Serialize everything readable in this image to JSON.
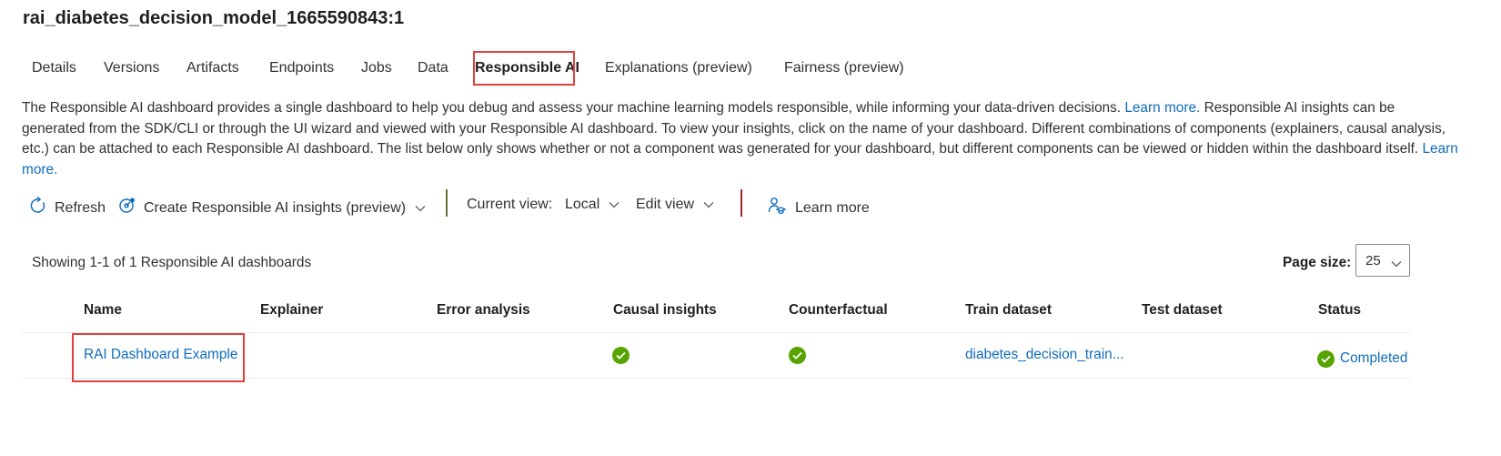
{
  "page_title": "rai_diabetes_decision_model_1665590843:1",
  "tabs": [
    {
      "label": "Details"
    },
    {
      "label": "Versions"
    },
    {
      "label": "Artifacts"
    },
    {
      "label": "Endpoints"
    },
    {
      "label": "Jobs"
    },
    {
      "label": "Data"
    },
    {
      "label": "Responsible AI"
    },
    {
      "label": "Explanations (preview)"
    },
    {
      "label": "Fairness (preview)"
    }
  ],
  "active_tab": "Responsible AI",
  "description": {
    "part1": "The Responsible AI dashboard provides a single dashboard to help you debug and assess your machine learning models responsible, while informing your data-driven decisions.",
    "link1": "Learn more.",
    "part2": "Responsible AI insights can be generated from the SDK/CLI or through the UI wizard and viewed with your Responsible AI dashboard. To view your insights, click on the name of your dashboard. Different combinations of components (explainers, causal analysis, etc.) can be attached to each Responsible AI dashboard. The list below only shows whether or not a component was generated for your dashboard, but different components can be viewed or hidden within the dashboard itself.",
    "link2": "Learn more."
  },
  "toolbar": {
    "refresh": "Refresh",
    "create": "Create Responsible AI insights (preview)",
    "current_view_label": "Current view:",
    "current_view_value": "Local",
    "edit_view": "Edit view",
    "learn_more": "Learn more",
    "icons": [
      "refresh-icon",
      "insights-icon",
      "learn-icon"
    ]
  },
  "list": {
    "showing": "Showing 1-1 of 1 Responsible AI dashboards",
    "page_size_label": "Page size:",
    "page_size_value": "25"
  },
  "table": {
    "columns": [
      "Name",
      "Explainer",
      "Error analysis",
      "Causal insights",
      "Counterfactual",
      "Train dataset",
      "Test dataset",
      "Status"
    ],
    "rows": [
      {
        "name": "RAI Dashboard Example",
        "explainer": "",
        "error_analysis": "",
        "causal_insights": true,
        "counterfactual": true,
        "train_dataset": "diabetes_decision_train...",
        "test_dataset": "",
        "status": "Completed"
      }
    ]
  },
  "colors": {
    "accent": "#0f6cbd",
    "highlight": "#e0413b",
    "success": "#57a300",
    "separator": "#a4262c"
  }
}
